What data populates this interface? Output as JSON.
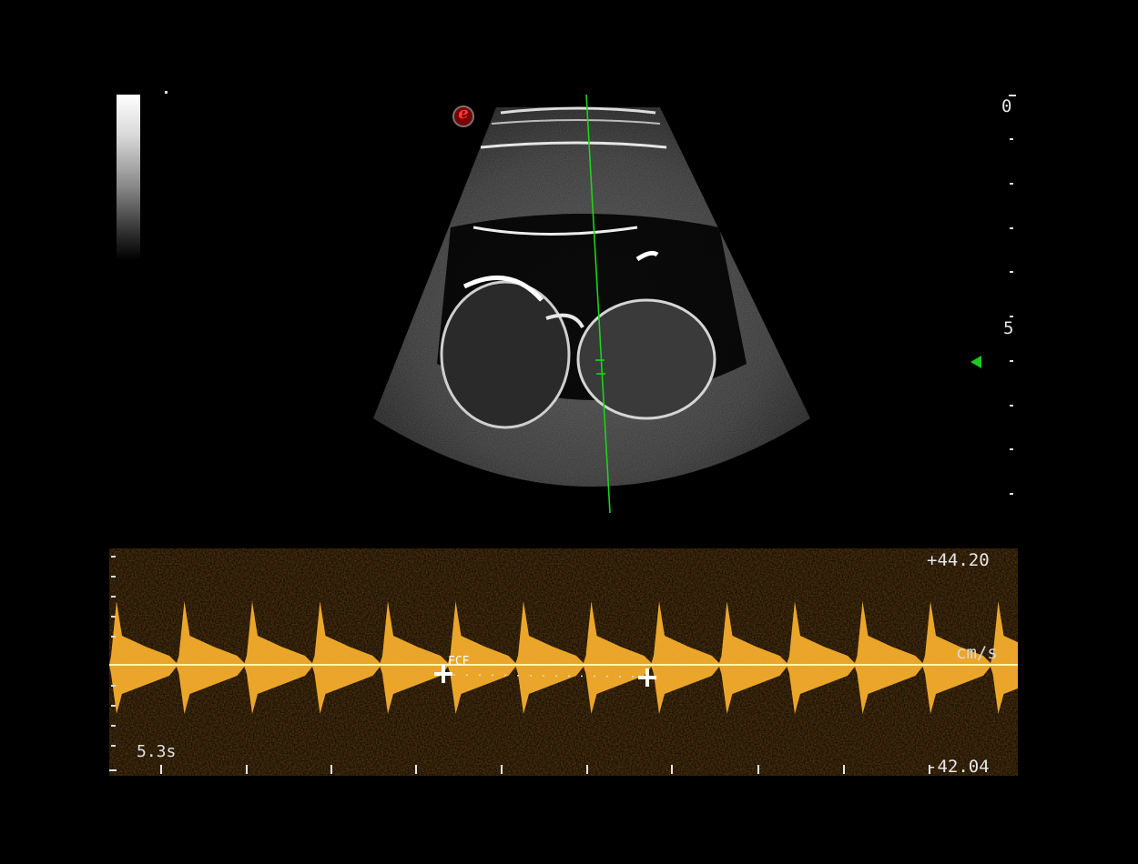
{
  "depth_scale": {
    "top_label": "0",
    "mid_label": "5"
  },
  "doppler": {
    "max_velocity": "+44.20",
    "min_velocity": "-42.04",
    "unit": "cm/s",
    "sweep_time": "5.3s",
    "caliper_label": "FCF"
  },
  "colors": {
    "doppler_spectrum": "#ffb52e",
    "cursor_line": "#19d419",
    "focus_marker": "#1ec81e"
  },
  "icons": [
    "logo-mark-icon",
    "caliper-cross-icon",
    "focus-marker-icon"
  ]
}
